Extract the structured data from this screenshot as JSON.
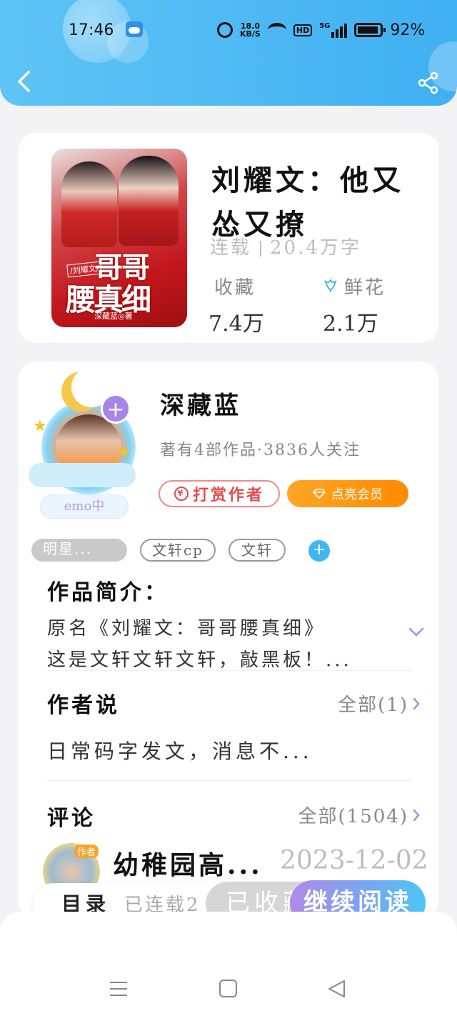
{
  "status_bar": {
    "time": "17:46",
    "net_speed_value": "18.0",
    "net_speed_unit": "KB/S",
    "hd": "HD",
    "signal": "5G",
    "battery": "92%"
  },
  "book": {
    "title": "刘耀文：他又怂又撩",
    "status": "连载",
    "word_count": "20.4万字",
    "favorites_label": "收藏",
    "favorites_value": "7.4万",
    "flowers_label": "鲜花",
    "flowers_value": "2.1万",
    "cover": {
      "tag": "/刘耀文/",
      "line1": "哥哥",
      "line2": "腰真细",
      "credit": "深藏蓝◎著"
    }
  },
  "author": {
    "name": "深藏蓝",
    "summary": "著有4部作品·3836人关注",
    "tip_button": "打赏作者",
    "vip_button": "点亮会员",
    "emo_badge": "emo中",
    "tags": [
      "明星...",
      "文轩cp",
      "文轩"
    ]
  },
  "intro": {
    "title": "作品简介：",
    "line1": "原名《刘耀文：哥哥腰真细》",
    "line2": "这是文轩文轩文轩，敲黑板！..."
  },
  "author_says": {
    "title": "作者说",
    "all_link": "全部(1)",
    "content": "日常码字发文，消息不..."
  },
  "comments": {
    "title": "评论",
    "all_link": "全部(1504)",
    "first_name": "幼稚园高...",
    "first_date": "2023-12-02",
    "author_badge": "作者"
  },
  "bottom_bar": {
    "toc": "目录",
    "serial": "已连载2",
    "collected": "已收藏",
    "continue": "继续阅读"
  },
  "colors": {
    "header": "#4fbaf3",
    "tip_red": "#e34b4b",
    "vip_orange": "#ff9a14",
    "accent_purple": "#a983e8"
  }
}
